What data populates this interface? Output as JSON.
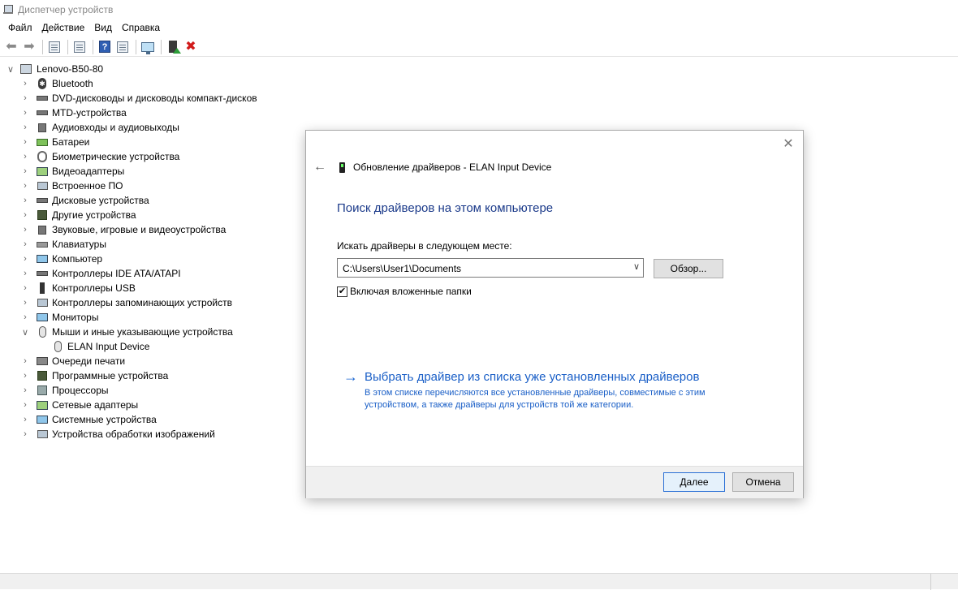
{
  "window": {
    "title": "Диспетчер устройств",
    "app_icon": "device-manager-icon"
  },
  "menu": [
    "Файл",
    "Действие",
    "Вид",
    "Справка"
  ],
  "toolbar": {
    "buttons": [
      "back-icon",
      "forward-icon",
      "properties-icon",
      "view-icon",
      "help-icon",
      "update-icon",
      "scan-icon",
      "enable-icon",
      "uninstall-icon"
    ]
  },
  "tree": {
    "root": "Lenovo-B50-80",
    "categories": [
      "Bluetooth",
      "DVD-дисководы и дисководы компакт-дисков",
      "MTD-устройства",
      "Аудиовходы и аудиовыходы",
      "Батареи",
      "Биометрические устройства",
      "Видеоадаптеры",
      "Встроенное ПО",
      "Дисковые устройства",
      "Другие устройства",
      "Звуковые, игровые и видеоустройства",
      "Клавиатуры",
      "Компьютер",
      "Контроллеры IDE ATA/ATAPI",
      "Контроллеры USB",
      "Контроллеры запоминающих устройств",
      "Мониторы",
      "Мыши и иные указывающие устройства",
      "Очереди печати",
      "Программные устройства",
      "Процессоры",
      "Сетевые адаптеры",
      "Системные устройства",
      "Устройства обработки изображений"
    ],
    "expanded_child": "ELAN Input Device"
  },
  "dialog": {
    "title": "Обновление драйверов - ELAN Input Device",
    "heading": "Поиск драйверов на этом компьютере",
    "search_label": "Искать драйверы в следующем месте:",
    "path_value": "C:\\Users\\User1\\Documents",
    "browse_label": "Обзор...",
    "include_subfolders_label": "Включая вложенные папки",
    "include_subfolders_checked": true,
    "link_text": "Выбрать драйвер из списка уже установленных драйверов",
    "link_description": "В этом списке перечисляются все установленные драйверы, совместимые с этим устройством, а также драйверы для устройств той же категории.",
    "next_label": "Далее",
    "cancel_label": "Отмена"
  }
}
